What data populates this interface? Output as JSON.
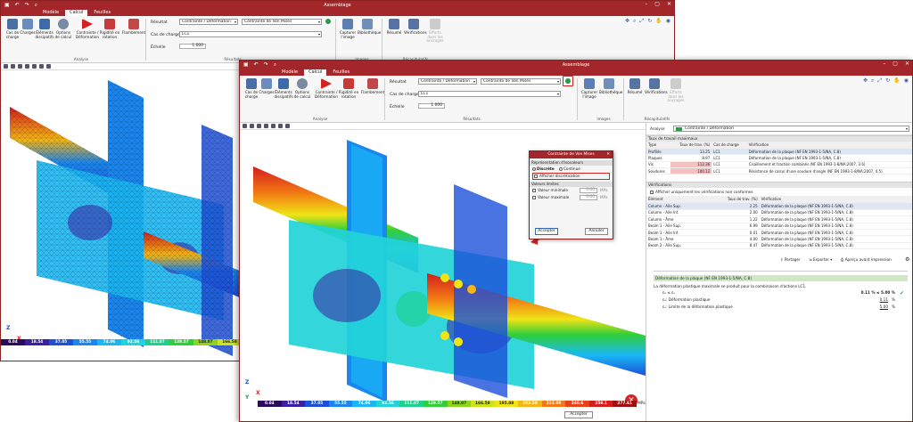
{
  "back_window": {
    "title": "Assemblage",
    "tabs": [
      "Modèle",
      "Calcul",
      "Feuilles"
    ],
    "active_tab": "Calcul",
    "buttons": [
      "Cas de charge",
      "Charges",
      "Éléments dissipatifs",
      "Options de calcul",
      "Contrainte / Déformation",
      "Rigidité en rotation",
      "Flambement"
    ],
    "group_analyse": "Analyse",
    "group_resultats": "Résultats",
    "group_images": "Images",
    "group_recap": "Récapitulatifs",
    "result_label": "Résultat",
    "result_value": "Contrainte / Déformation",
    "result_sub": "Contrainte de Von Mises",
    "load_case_label": "Cas de charge",
    "load_case_value": "LC1",
    "scale_label": "Échelle",
    "scale_value": "1.000",
    "images_buttons": [
      "Capturer l'image",
      "Bibliothèque"
    ],
    "recap_buttons": [
      "Résumé",
      "Vérifications",
      "Efforts dans les ancrages"
    ],
    "legend": [
      "0.04",
      "18.54",
      "37.05",
      "55.55",
      "74.06",
      "92.56",
      "111.07",
      "129.57",
      "148.07",
      "166.58"
    ]
  },
  "front_window": {
    "title": "Assemblage",
    "tabs": [
      "Modèle",
      "Calcul",
      "Feuilles"
    ],
    "active_tab": "Calcul",
    "buttons": [
      "Cas de charge",
      "Charges",
      "Éléments dissipatifs",
      "Options de calcul",
      "Contrainte / Déformation",
      "Rigidité en rotation",
      "Flambement"
    ],
    "group_analyse": "Analyse",
    "group_resultats": "Résultats",
    "group_images": "Images",
    "group_recap": "Récapitulatifs",
    "result_label": "Résultat",
    "result_value": "Contrainte / Déformation",
    "result_sub": "Contrainte de Von Mises",
    "load_case_label": "Cas de charge",
    "load_case_value": "LC1",
    "scale_label": "Échelle",
    "scale_value": "1.000",
    "images_buttons": [
      "Capturer l'image",
      "Bibliothèque"
    ],
    "recap_buttons": [
      "Résumé",
      "Vérifications",
      "Efforts dans les ancrages"
    ],
    "legend": [
      "0.04",
      "18.54",
      "37.05",
      "55.55",
      "74.06",
      "92.56",
      "111.07",
      "129.57",
      "148.07",
      "166.58",
      "185.08",
      "203.59",
      "222.09",
      "240.6",
      "259.1",
      "277.61"
    ],
    "legend_unit": "MPa",
    "accept_label": "Accepter"
  },
  "dialog": {
    "title": "Contrainte de Von Mises",
    "sec_repr": "Représentation d'isovaleurs",
    "opt_discrete": "Discrète",
    "opt_continuous": "Continue",
    "show_mesh": "Afficher discrétisation",
    "sec_limits": "Valeurs limites",
    "min_label": "Valeur minimale",
    "max_label": "Valeur maximale",
    "min_value": "0.00",
    "max_value": "0.00",
    "unit": "MPa",
    "accept": "Accepter",
    "cancel": "Annuler"
  },
  "panel": {
    "analysis_label": "Analyse",
    "analysis_value": "Contrainte / Déformation",
    "rates_title": "Taux de travail maximaux",
    "rates_headers": [
      "Type",
      "Taux de trav. (%)",
      "Cas de charge",
      "Vérification"
    ],
    "rates_rows": [
      [
        "Profilés",
        "13.25",
        "LC1",
        "Déformation de la plaque (NF EN 1993-1-5/NA, C.8)"
      ],
      [
        "Plaques",
        "8.97",
        "LC1",
        "Déformation de la plaque (NF EN 1993-1-5/NA, C.8)"
      ],
      [
        "Vis",
        "112.36",
        "LC1",
        "Cisaillement et traction combinés (NF EN 1993-1-8/NA:2007, 3.6)"
      ],
      [
        "Soudures",
        "100.12",
        "LC1",
        "Résistance de calcul d'une soudure d'angle (NF EN 1993-1-8/NA:2007, 4.5)"
      ]
    ],
    "checks_title": "Vérifications",
    "checks_filter": "Afficher uniquement les vérifications non conformes",
    "checks_headers": [
      "Élément",
      "Taux de trav. (%)",
      "Vérification"
    ],
    "checks_rows": [
      [
        "Column - Aile Sup.",
        "2.25",
        "Déformation de la plaque (NF EN 1993-1-5/NA, C.8)"
      ],
      [
        "Column - Aile Inf.",
        "2.00",
        "Déformation de la plaque (NF EN 1993-1-5/NA, C.8)"
      ],
      [
        "Column - Âme",
        "1.22",
        "Déformation de la plaque (NF EN 1993-1-5/NA, C.8)"
      ],
      [
        "Beam 1 - Aile Sup.",
        "6.99",
        "Déformation de la plaque (NF EN 1993-1-5/NA, C.8)"
      ],
      [
        "Beam 1 - Aile Inf.",
        "0.01",
        "Déformation de la plaque (NF EN 1993-1-5/NA, C.8)"
      ],
      [
        "Beam 1 - Âme",
        "4.00",
        "Déformation de la plaque (NF EN 1993-1-5/NA, C.8)"
      ],
      [
        "Beam 2 - Aile Sup.",
        "8.47",
        "Déformation de la plaque (NF EN 1993-1-5/NA, C.8)"
      ]
    ],
    "share": "Partager",
    "export": "Exporter",
    "preview": "Aperçu avant impression",
    "detail_title": "Déformation de la plaque (NF EN 1993-1-5/NA, C.8)",
    "detail_text": "La déformation plastique maximale se produit pour la combinaison d'actions LC1.",
    "detail_formula": "εₑ ≤ εᵤ",
    "detail_result": "0.11 % ≤ 5.00 %",
    "detail_line1": "εₑ: Déformation plastique",
    "detail_line1_val": "0.11",
    "detail_line2": "εᵤ: Limite de la déformation plastique",
    "detail_line2_val": "5.00",
    "pct": "%"
  },
  "colors": {
    "brand": "#a2262a",
    "scale": [
      "#2a0a5c",
      "#3b1f9e",
      "#1c50d8",
      "#1a86f0",
      "#19b8f5",
      "#22d4d8",
      "#1cd18a",
      "#2fcf3a",
      "#8bd61d",
      "#cde31a",
      "#f0e316",
      "#f5b515",
      "#f27a14",
      "#e8421a",
      "#d41d1d",
      "#9e0f0f"
    ]
  }
}
